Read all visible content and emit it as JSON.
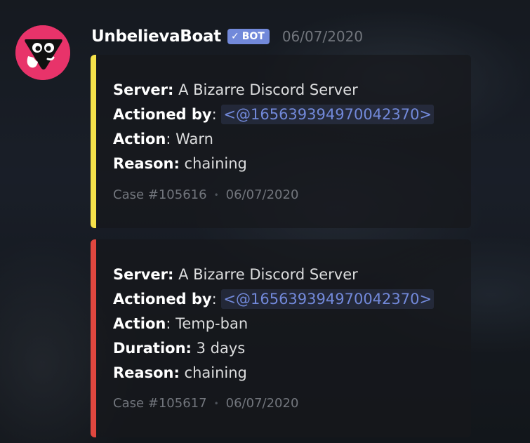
{
  "message": {
    "username": "UnbelievaBoat",
    "bot_tag": "BOT",
    "bot_check": "✓",
    "timestamp": "06/07/2020",
    "avatar_icon": "unbelievaboat-logo-icon",
    "avatar_color": "#e8336a"
  },
  "embeds": [
    {
      "accent_color": "#f5e14a",
      "fields": {
        "server_label": "Server:",
        "server_value": "A Bizarre Discord Server",
        "actioned_label": "Actioned by",
        "actioned_sep": ":",
        "actioned_value": "<@165639394970042370>",
        "action_label": "Action",
        "action_sep": ":",
        "action_value": "Warn",
        "reason_label": "Reason:",
        "reason_value": "chaining"
      },
      "footer": {
        "case": "Case #105616",
        "separator": "•",
        "date": "06/07/2020"
      }
    },
    {
      "accent_color": "#e0473f",
      "fields": {
        "server_label": "Server:",
        "server_value": "A Bizarre Discord Server",
        "actioned_label": "Actioned by",
        "actioned_sep": ":",
        "actioned_value": "<@165639394970042370>",
        "action_label": "Action",
        "action_sep": ":",
        "action_value": "Temp-ban",
        "duration_label": "Duration:",
        "duration_value": "3 days",
        "reason_label": "Reason:",
        "reason_value": "chaining"
      },
      "footer": {
        "case": "Case #105617",
        "separator": "•",
        "date": "06/07/2020"
      }
    }
  ]
}
